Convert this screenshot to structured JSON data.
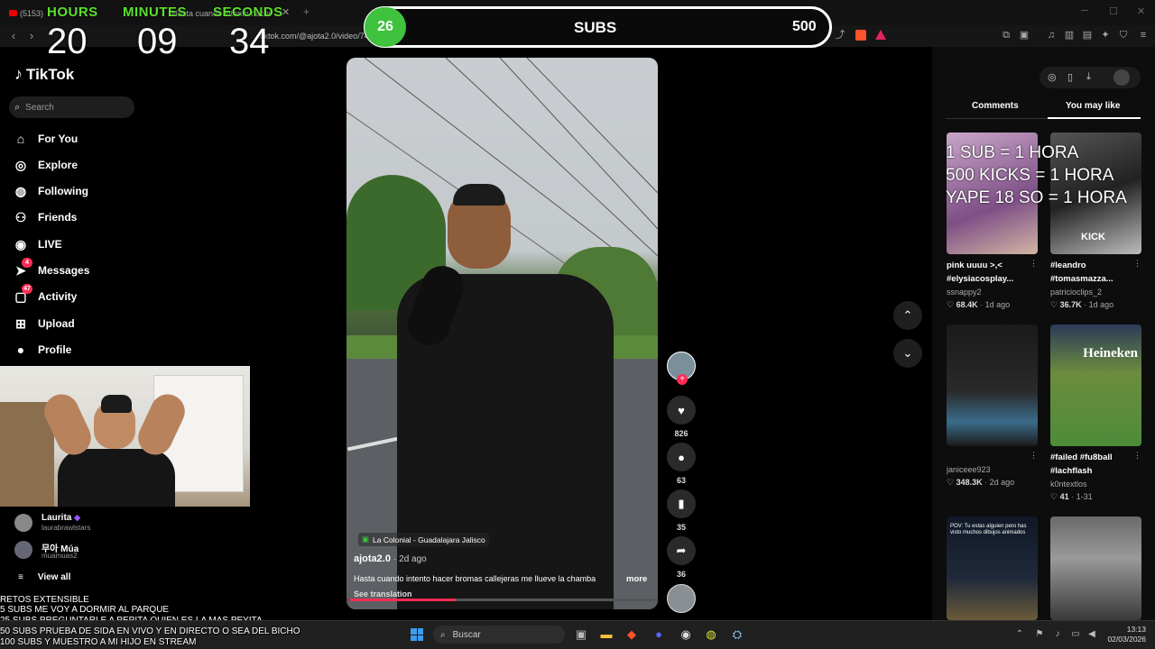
{
  "browser": {
    "tab_count": "(5153)",
    "tab_label": "Hasta cuando intento hacer broma...",
    "url": "tiktok.com/@ajota2.0/video/7488256847126",
    "url_suffix": "488256847126"
  },
  "timer": {
    "hours_label": "HOURS",
    "minutes_label": "MINUTES",
    "seconds_label": "SECONDS",
    "hours": "20",
    "minutes": "09",
    "seconds": "34"
  },
  "subs_bar": {
    "current": "26",
    "label": "SUBS",
    "goal": "500",
    "progress": 0.052,
    "fill_color": "#3fc33f"
  },
  "tiktok": {
    "logo": "TikTok",
    "search_placeholder": "Search",
    "nav": [
      {
        "label": "For You",
        "icon": "home-icon",
        "badge": ""
      },
      {
        "label": "Explore",
        "icon": "compass-icon",
        "badge": ""
      },
      {
        "label": "Following",
        "icon": "avatar-icon",
        "badge": ""
      },
      {
        "label": "Friends",
        "icon": "friends-icon",
        "badge": ""
      },
      {
        "label": "LIVE",
        "icon": "live-icon",
        "badge": ""
      },
      {
        "label": "Messages",
        "icon": "send-icon",
        "badge": "4"
      },
      {
        "label": "Activity",
        "icon": "inbox-icon",
        "badge": "47"
      },
      {
        "label": "Upload",
        "icon": "plus-square-icon",
        "badge": ""
      },
      {
        "label": "Profile",
        "icon": "profile-icon",
        "badge": ""
      }
    ],
    "following_accounts": [
      {
        "name": "Laurita",
        "handle": "laurabrawlstars"
      },
      {
        "name": "무아 Múa",
        "handle": "muamuas2"
      }
    ],
    "view_all": "View all"
  },
  "video": {
    "location": "La Colonial - Guadalajara Jalisco",
    "author": "ajota2.0",
    "age": "2d ago",
    "caption": "Hasta cuando intento hacer bromas callejeras me llueve la chamba",
    "more": "more",
    "see_translation": "See translation",
    "watch_progress": 0.34,
    "likes": "826",
    "comments": "63",
    "saves": "35",
    "shares": "36"
  },
  "right_panel": {
    "tab_comments": "Comments",
    "tab_you_may_like": "You may like",
    "overlay_lines": [
      "1 SUB = 1 HORA",
      "500 KICKS = 1 HORA",
      "YAPE 18 SO = 1 HORA"
    ],
    "videos": [
      {
        "title1": "pink uuuu >,<",
        "title2": "#elysiacosplay...",
        "user": "ssnappy2",
        "likes": "68.4K",
        "age": "1d ago",
        "thumb_label": ""
      },
      {
        "title1": "#leandro",
        "title2": "#tomasmazza...",
        "user": "patricioclips_2",
        "likes": "36.7K",
        "age": "1d ago",
        "thumb_label": "KICK"
      },
      {
        "title1": "",
        "title2": "",
        "user": "janiceee923",
        "likes": "348.3K",
        "age": "2d ago",
        "thumb_label": ""
      },
      {
        "title1": "#failed #fu8ball",
        "title2": "#lachflash",
        "user": "k0ntextlos",
        "likes": "41",
        "age": "1-31",
        "thumb_label": "Heineken"
      },
      {
        "title1": "",
        "title2": "",
        "user": "",
        "likes": "",
        "age": "",
        "thumb_label": "POV: Tu estas alguien pero has visto muchos dibujos animados"
      },
      {
        "title1": "",
        "title2": "",
        "user": "",
        "likes": "",
        "age": "",
        "thumb_label": ""
      }
    ]
  },
  "retos": {
    "title": "RETOS EXTENSIBLE",
    "lines": [
      "5 SUBS ME VOY A DORMIR AL PARQUE",
      "25 SUBS PREGUNTARLE A PEPITA QUIEN ES LA MAS PEYITA",
      "50 SUBS PRUEBA DE SIDA EN VIVO Y EN DIRECTO O SEA DEL BICHO",
      "100 SUBS Y MUESTRO A MI HIJO EN STREAM"
    ]
  },
  "taskbar": {
    "search": "Buscar",
    "time": "13:13",
    "date": "02/03/2026"
  }
}
